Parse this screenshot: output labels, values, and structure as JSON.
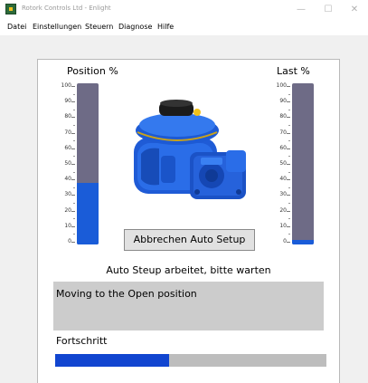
{
  "window": {
    "title": "Rotork Controls Ltd - Enlight",
    "controls": {
      "minimize": "—",
      "maximize": "☐",
      "close": "✕"
    }
  },
  "menu": [
    "Datei",
    "Einstellungen",
    "Steuern",
    "Diagnose",
    "Hilfe"
  ],
  "gauges": {
    "position": {
      "title": "Position %",
      "value": 38
    },
    "load": {
      "title": "Last %",
      "value": 3
    },
    "scale_labels": [
      "100",
      "90",
      "80",
      "70",
      "60",
      "50",
      "40",
      "30",
      "20",
      "10",
      "0"
    ]
  },
  "image": {
    "name": "rotork-actuator-image"
  },
  "abort_button": {
    "label": "Abbrechen Auto Setup"
  },
  "status_text": "Auto Steup arbeitet, bitte warten",
  "message_text": "Moving to the Open position",
  "progress": {
    "label": "Fortschritt",
    "value": 0.42
  },
  "colors": {
    "bar_background": "#6e6b86",
    "bar_fill": "#1a5cd8",
    "progress_fill": "#1145d0"
  }
}
